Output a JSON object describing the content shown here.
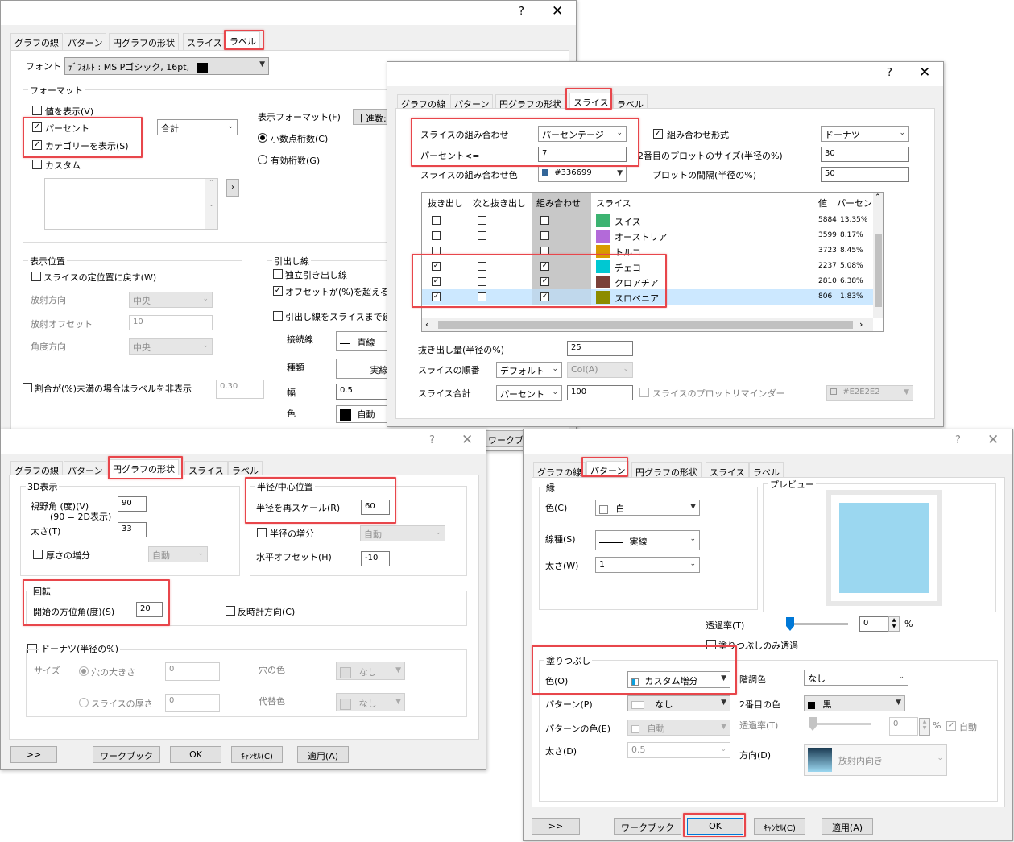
{
  "common": {
    "help": "?",
    "close": "✕",
    "tab_line": "グラフの線",
    "tab_pattern": "パターン",
    "tab_pie": "円グラフの形状",
    "tab_slice": "スライス",
    "tab_label": "ラベル"
  },
  "label_dialog": {
    "font_label": "フォント",
    "font_value": "ﾃﾞﾌｫﾙﾄ : MS Pゴシック, 16pt,",
    "format_group": "フォーマット",
    "show_value": "値を表示(V)",
    "percent": "パーセント",
    "show_category": "カテゴリーを表示(S)",
    "custom": "カスタム",
    "sum_value": "合計",
    "display_format": "表示フォーマット(F)",
    "decimal_format_btn": "十進数:",
    "decimal_places": "小数点桁数(C)",
    "significant": "有効桁数(G)",
    "position_group": "表示位置",
    "reset_position": "スライスの定位置に戻す(W)",
    "radial_dir": "放射方向",
    "radial_dir_value": "中央",
    "radial_offset": "放射オフセット",
    "radial_offset_value": "10",
    "angle_dir": "角度方向",
    "angle_dir_value": "中央",
    "hide_label": "割合が(%)未満の場合はラベルを非表示",
    "hide_value": "0.30",
    "leader_group": "引出し線",
    "independent": "独立引き出し線",
    "offset_over": "オフセットが(%)を超える場",
    "leader_to_slice": "引出し線をスライスまで延",
    "connect": "接続線",
    "connect_value": "直線",
    "kind": "種類",
    "kind_value": "実線",
    "width": "幅",
    "width_value": "0.5",
    "color": "色",
    "color_value": "自動",
    "workbook_fragment": "ワークブ"
  },
  "slice_dialog": {
    "combine_label": "スライスの組み合わせ",
    "combine_value": "パーセンテージ",
    "percent_le": "パーセント<=",
    "percent_value": "7",
    "combine_color": "スライスの組み合わせ色",
    "combine_color_value": "#336699",
    "combine_format": "組み合わせ形式",
    "combine_format_value": "ドーナツ",
    "second_size": "2番目のプロットのサイズ(半径の%)",
    "second_size_value": "30",
    "plot_gap": "プロットの間隔(半径の%)",
    "plot_gap_value": "50",
    "table_headers": [
      "抜き出し",
      "次と抜き出し",
      "組み合わせ",
      "スライス",
      "値",
      "パーセン"
    ],
    "table_rows": [
      {
        "explode": false,
        "next": false,
        "combine": false,
        "name": "スイス",
        "color": "#3cb371",
        "value": "5884",
        "percent": "13.35%"
      },
      {
        "explode": false,
        "next": false,
        "combine": false,
        "name": "オーストリア",
        "color": "#b36ad9",
        "value": "3599",
        "percent": "8.17%"
      },
      {
        "explode": false,
        "next": false,
        "combine": false,
        "name": "トルコ",
        "color": "#d99a00",
        "value": "3723",
        "percent": "8.45%"
      },
      {
        "explode": true,
        "next": false,
        "combine": true,
        "name": "チェコ",
        "color": "#00c8d2",
        "value": "2237",
        "percent": "5.08%"
      },
      {
        "explode": true,
        "next": false,
        "combine": true,
        "name": "クロアチア",
        "color": "#7a4038",
        "value": "2810",
        "percent": "6.38%"
      },
      {
        "explode": true,
        "next": false,
        "combine": true,
        "name": "スロベニア",
        "color": "#8c8c00",
        "value": "806",
        "percent": "1.83%"
      }
    ],
    "explode_amount": "抜き出し量(半径の%)",
    "explode_amount_value": "25",
    "order": "スライスの順番",
    "order_value": "デフォルト",
    "order_col": "Col(A)",
    "total": "スライス合計",
    "total_mode": "パーセント",
    "total_value": "100",
    "reminder": "スライスのプロットリマインダー",
    "reminder_color": "#E2E2E2"
  },
  "pie_dialog": {
    "group_3d": "3D表示",
    "view_angle": "視野角 (度)(V)",
    "view_angle_note": "(90 = 2D表示)",
    "view_angle_value": "90",
    "thickness": "太さ(T)",
    "thickness_value": "33",
    "thickness_inc": "厚さの増分",
    "thickness_inc_value": "自動",
    "radius_group": "半径/中心位置",
    "rescale": "半径を再スケール(R)",
    "rescale_value": "60",
    "radius_inc": "半径の増分",
    "radius_inc_value": "自動",
    "h_offset": "水平オフセット(H)",
    "h_offset_value": "-10",
    "rotation_group": "回転",
    "start_angle": "開始の方位角(度)(S)",
    "start_angle_value": "20",
    "ccw": "反時計方向(C)",
    "donut_group": "ドーナツ(半径の%)",
    "size": "サイズ",
    "hole_size": "穴の大きさ",
    "hole_size_value": "0",
    "slice_thickness": "スライスの厚さ",
    "slice_thickness_value": "0",
    "hole_color": "穴の色",
    "hole_color_value": "なし",
    "alt_color": "代替色",
    "alt_color_value": "なし",
    "btn_more": ">>",
    "btn_workbook": "ワークブック",
    "btn_ok": "OK",
    "btn_cancel": "ｷｬﾝｾﾙ(C)",
    "btn_apply": "適用(A)"
  },
  "pattern_dialog": {
    "border_group": "縁",
    "color": "色(C)",
    "color_value": "白",
    "line_type": "線種(S)",
    "line_type_value": "実線",
    "thickness": "太さ(W)",
    "thickness_value": "1",
    "preview_group": "プレビュー",
    "transparency": "透過率(T)",
    "transparency_value": "0",
    "percent_unit": "%",
    "fill_only": "塗りつぶしのみ透過",
    "fill_group": "塗りつぶし",
    "fill_color": "色(O)",
    "fill_color_value": "カスタム増分",
    "gradient": "階調色",
    "gradient_value": "なし",
    "pattern": "パターン(P)",
    "pattern_value": "なし",
    "second_color": "2番目の色",
    "second_color_value": "黒",
    "pattern_color": "パターンの色(E)",
    "pattern_color_value": "自動",
    "transparency2": "透過率(T)",
    "transparency2_value": "0",
    "auto": "自動",
    "width": "太さ(D)",
    "width_value": "0.5",
    "direction": "方向(D)",
    "direction_value": "放射内向き",
    "fill_hex": "#9bd7f0",
    "btn_more": ">>",
    "btn_workbook": "ワークブック",
    "btn_ok": "OK",
    "btn_cancel": "ｷｬﾝｾﾙ(C)",
    "btn_apply": "適用(A)"
  }
}
